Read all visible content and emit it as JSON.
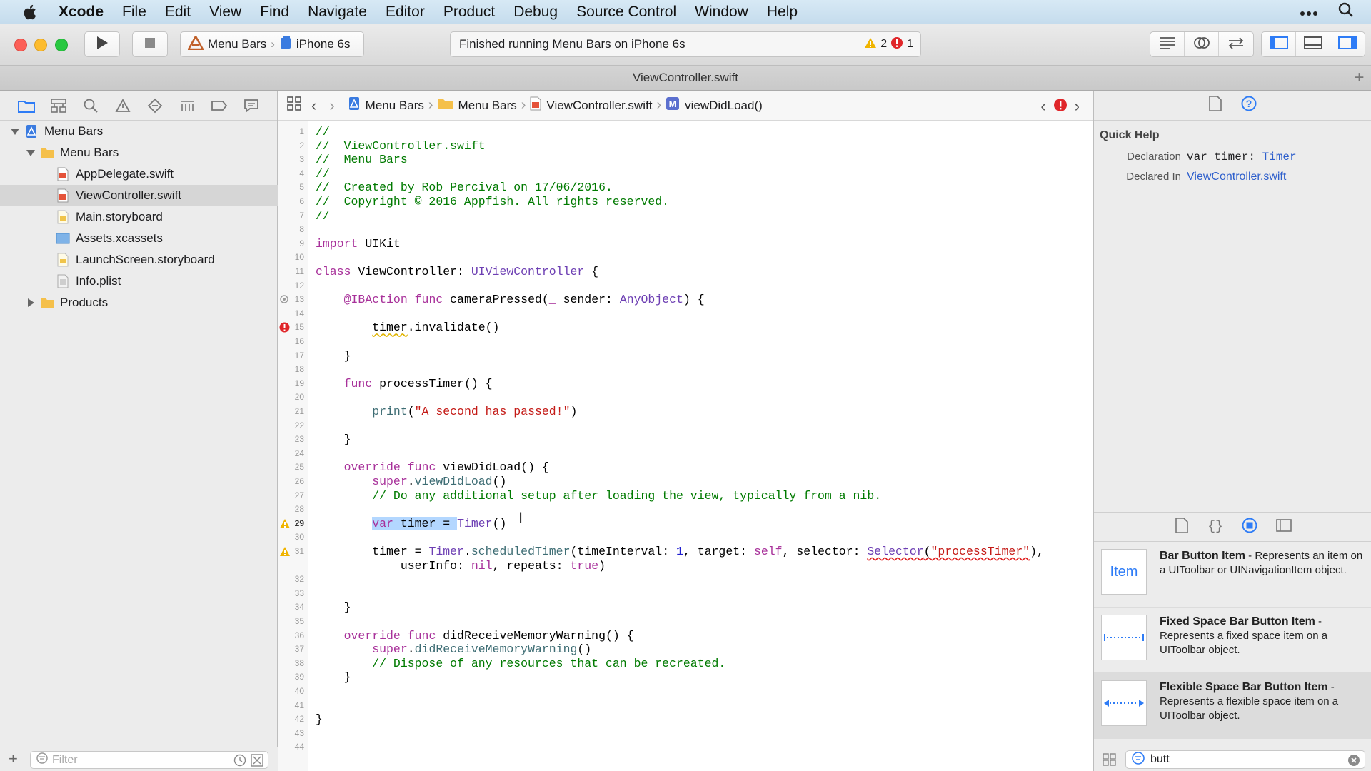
{
  "menubar": {
    "app": "Xcode",
    "items": [
      "File",
      "Edit",
      "View",
      "Find",
      "Navigate",
      "Editor",
      "Product",
      "Debug",
      "Source Control",
      "Window",
      "Help"
    ]
  },
  "toolbar": {
    "scheme_project": "Menu Bars",
    "scheme_device": "iPhone 6s",
    "status_text": "Finished running Menu Bars on iPhone 6s",
    "warning_count": "2",
    "error_count": "1"
  },
  "tab": {
    "title": "ViewController.swift"
  },
  "navigator": {
    "tree": [
      {
        "label": "Menu Bars",
        "indent": 0,
        "kind": "project",
        "disclosure": "open"
      },
      {
        "label": "Menu Bars",
        "indent": 1,
        "kind": "folder",
        "disclosure": "open"
      },
      {
        "label": "AppDelegate.swift",
        "indent": 2,
        "kind": "swift"
      },
      {
        "label": "ViewController.swift",
        "indent": 2,
        "kind": "swift",
        "selected": true
      },
      {
        "label": "Main.storyboard",
        "indent": 2,
        "kind": "storyboard"
      },
      {
        "label": "Assets.xcassets",
        "indent": 2,
        "kind": "assets"
      },
      {
        "label": "LaunchScreen.storyboard",
        "indent": 2,
        "kind": "storyboard"
      },
      {
        "label": "Info.plist",
        "indent": 2,
        "kind": "plist"
      },
      {
        "label": "Products",
        "indent": 1,
        "kind": "folder",
        "disclosure": "closed"
      }
    ],
    "filter_placeholder": "Filter"
  },
  "jumpbar": {
    "crumbs": [
      "Menu Bars",
      "Menu Bars",
      "ViewController.swift",
      "viewDidLoad()"
    ]
  },
  "code": {
    "lines": [
      {
        "n": 1,
        "t": [
          [
            "c-com",
            "//"
          ]
        ]
      },
      {
        "n": 2,
        "t": [
          [
            "c-com",
            "//  ViewController.swift"
          ]
        ]
      },
      {
        "n": 3,
        "t": [
          [
            "c-com",
            "//  Menu Bars"
          ]
        ]
      },
      {
        "n": 4,
        "t": [
          [
            "c-com",
            "//"
          ]
        ]
      },
      {
        "n": 5,
        "t": [
          [
            "c-com",
            "//  Created by Rob Percival on 17/06/2016."
          ]
        ]
      },
      {
        "n": 6,
        "t": [
          [
            "c-com",
            "//  Copyright © 2016 Appfish. All rights reserved."
          ]
        ]
      },
      {
        "n": 7,
        "t": [
          [
            "c-com",
            "//"
          ]
        ]
      },
      {
        "n": 8,
        "t": []
      },
      {
        "n": 9,
        "t": [
          [
            "c-kw",
            "import"
          ],
          [
            "c-pl",
            " UIKit"
          ]
        ]
      },
      {
        "n": 10,
        "t": []
      },
      {
        "n": 11,
        "t": [
          [
            "c-kw",
            "class"
          ],
          [
            "c-pl",
            " ViewController: "
          ],
          [
            "c-type",
            "UIViewController"
          ],
          [
            "c-pl",
            " {"
          ]
        ]
      },
      {
        "n": 12,
        "t": []
      },
      {
        "n": 13,
        "t": [
          [
            "c-pl",
            "    "
          ],
          [
            "c-kw",
            "@IBAction"
          ],
          [
            "c-pl",
            " "
          ],
          [
            "c-kw",
            "func"
          ],
          [
            "c-pl",
            " cameraPressed("
          ],
          [
            "c-kw",
            "_"
          ],
          [
            "c-pl",
            " sender: "
          ],
          [
            "c-type",
            "AnyObject"
          ],
          [
            "c-pl",
            ") {"
          ]
        ],
        "marker": "outlet"
      },
      {
        "n": 14,
        "t": []
      },
      {
        "n": 15,
        "t": [
          [
            "c-pl",
            "        "
          ],
          [
            "c-pl squig",
            "timer"
          ],
          [
            "c-pl",
            ".invalidate()"
          ]
        ],
        "marker": "error"
      },
      {
        "n": 16,
        "t": []
      },
      {
        "n": 17,
        "t": [
          [
            "c-pl",
            "    }"
          ]
        ]
      },
      {
        "n": 18,
        "t": []
      },
      {
        "n": 19,
        "t": [
          [
            "c-pl",
            "    "
          ],
          [
            "c-kw",
            "func"
          ],
          [
            "c-pl",
            " processTimer() {"
          ]
        ]
      },
      {
        "n": 20,
        "t": []
      },
      {
        "n": 21,
        "t": [
          [
            "c-pl",
            "        "
          ],
          [
            "c-fn",
            "print"
          ],
          [
            "c-pl",
            "("
          ],
          [
            "c-str",
            "\"A second has passed!\""
          ],
          [
            "c-pl",
            ")"
          ]
        ]
      },
      {
        "n": 22,
        "t": []
      },
      {
        "n": 23,
        "t": [
          [
            "c-pl",
            "    }"
          ]
        ]
      },
      {
        "n": 24,
        "t": []
      },
      {
        "n": 25,
        "t": [
          [
            "c-pl",
            "    "
          ],
          [
            "c-kw",
            "override"
          ],
          [
            "c-pl",
            " "
          ],
          [
            "c-kw",
            "func"
          ],
          [
            "c-pl",
            " viewDidLoad() {"
          ]
        ]
      },
      {
        "n": 26,
        "t": [
          [
            "c-pl",
            "        "
          ],
          [
            "c-kw",
            "super"
          ],
          [
            "c-pl",
            "."
          ],
          [
            "c-fn",
            "viewDidLoad"
          ],
          [
            "c-pl",
            "()"
          ]
        ]
      },
      {
        "n": 27,
        "t": [
          [
            "c-pl",
            "        "
          ],
          [
            "c-com",
            "// Do any additional setup after loading the view, typically from a nib."
          ]
        ]
      },
      {
        "n": 28,
        "t": []
      },
      {
        "n": 29,
        "t": [
          [
            "c-pl",
            "        "
          ],
          [
            "c-kw sel-hl",
            "var"
          ],
          [
            "c-pl sel-hl",
            " timer = "
          ],
          [
            "c-type",
            "Timer"
          ],
          [
            "c-pl",
            "() "
          ]
        ],
        "marker": "warning",
        "hot": true
      },
      {
        "n": 30,
        "t": []
      },
      {
        "n": 31,
        "t": [
          [
            "c-pl",
            "        timer = "
          ],
          [
            "c-type",
            "Timer"
          ],
          [
            "c-pl",
            "."
          ],
          [
            "c-fn",
            "scheduledTimer"
          ],
          [
            "c-pl",
            "(timeInterval: "
          ],
          [
            "c-num",
            "1"
          ],
          [
            "c-pl",
            ", target: "
          ],
          [
            "c-kw",
            "self"
          ],
          [
            "c-pl",
            ", selector: "
          ],
          [
            "c-type squig-r",
            "Selector"
          ],
          [
            "c-pl squig-r",
            "("
          ],
          [
            "c-str squig-r",
            "\"processTimer\""
          ],
          [
            "c-pl",
            "),"
          ]
        ],
        "marker": "warning"
      },
      {
        "n": "",
        "t": [
          [
            "c-pl",
            "            userInfo: "
          ],
          [
            "c-kw",
            "nil"
          ],
          [
            "c-pl",
            ", repeats: "
          ],
          [
            "c-kw",
            "true"
          ],
          [
            "c-pl",
            ")"
          ]
        ]
      },
      {
        "n": 32,
        "t": []
      },
      {
        "n": 33,
        "t": []
      },
      {
        "n": 34,
        "t": [
          [
            "c-pl",
            "    }"
          ]
        ]
      },
      {
        "n": 35,
        "t": []
      },
      {
        "n": 36,
        "t": [
          [
            "c-pl",
            "    "
          ],
          [
            "c-kw",
            "override"
          ],
          [
            "c-pl",
            " "
          ],
          [
            "c-kw",
            "func"
          ],
          [
            "c-pl",
            " didReceiveMemoryWarning() {"
          ]
        ]
      },
      {
        "n": 37,
        "t": [
          [
            "c-pl",
            "        "
          ],
          [
            "c-kw",
            "super"
          ],
          [
            "c-pl",
            "."
          ],
          [
            "c-fn",
            "didReceiveMemoryWarning"
          ],
          [
            "c-pl",
            "()"
          ]
        ]
      },
      {
        "n": 38,
        "t": [
          [
            "c-pl",
            "        "
          ],
          [
            "c-com",
            "// Dispose of any resources that can be recreated."
          ]
        ]
      },
      {
        "n": 39,
        "t": [
          [
            "c-pl",
            "    }"
          ]
        ]
      },
      {
        "n": 40,
        "t": []
      },
      {
        "n": 41,
        "t": []
      },
      {
        "n": 42,
        "t": [
          [
            "c-pl",
            "}"
          ]
        ]
      },
      {
        "n": 43,
        "t": []
      },
      {
        "n": 44,
        "t": []
      }
    ]
  },
  "quick_help": {
    "title": "Quick Help",
    "declaration_label": "Declaration",
    "declaration_kw": "var timer:",
    "declaration_type": "Timer",
    "declared_in_label": "Declared In",
    "declared_in_value": "ViewController.swift"
  },
  "library": {
    "items": [
      {
        "icon_text": "Item",
        "title": "Bar Button Item",
        "desc": " - Represents an item on a UIToolbar or UINavigationItem object."
      },
      {
        "icon_text": "",
        "title": "Fixed Space Bar Button Item",
        "desc": " - Represents a fixed space item on a UIToolbar object."
      },
      {
        "icon_text": "",
        "title": "Flexible Space Bar Button Item",
        "desc": " - Represents a flexible space item on a UIToolbar object."
      }
    ],
    "search_value": "butt"
  },
  "colors": {
    "accent": "#2e7cf6",
    "warning": "#f0b400",
    "error": "#e0262a"
  }
}
